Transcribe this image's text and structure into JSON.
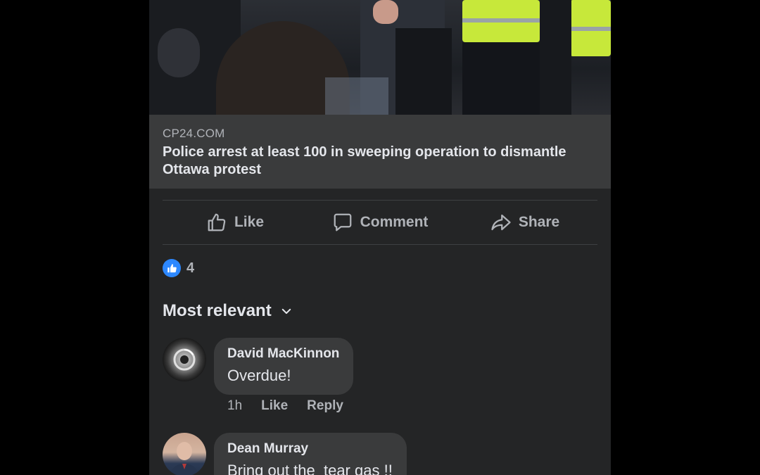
{
  "link": {
    "domain": "CP24.COM",
    "headline": "Police arrest at least 100 in sweeping operation to dismantle Ottawa protest"
  },
  "actions": {
    "like": "Like",
    "comment": "Comment",
    "share": "Share"
  },
  "reactions": {
    "count": "4"
  },
  "sort": {
    "label": "Most relevant"
  },
  "comments": [
    {
      "author": "David MacKinnon",
      "text": "Overdue!",
      "time": "1h",
      "like": "Like",
      "reply": "Reply"
    },
    {
      "author": "Dean Murray",
      "text": "Bring out the  tear gas !!"
    }
  ],
  "colors": {
    "background": "#242526",
    "bubble": "#3a3b3c",
    "accent": "#2d88ff",
    "primary_text": "#e4e6eb",
    "secondary_text": "#b0b3b8"
  },
  "icons": {
    "like": "thumbs-up-icon",
    "comment": "speech-bubble-icon",
    "share": "share-arrow-icon",
    "sort": "chevron-down-icon",
    "reaction": "like-reaction-icon"
  }
}
